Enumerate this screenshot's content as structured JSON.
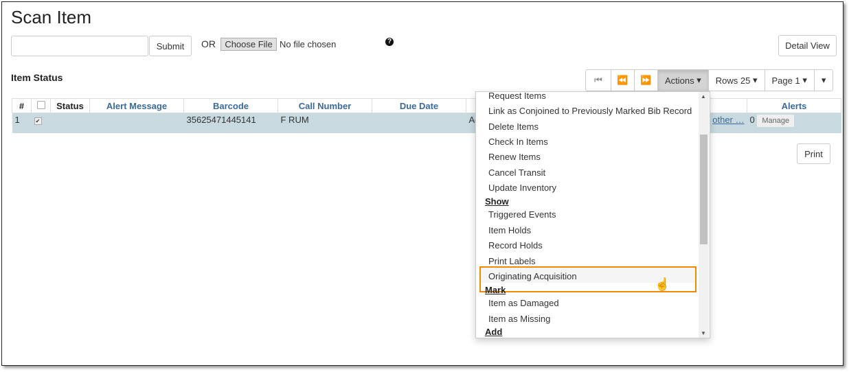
{
  "page": {
    "title": "Scan Item"
  },
  "scan": {
    "submit": "Submit",
    "or": "OR",
    "choose_file": "Choose File",
    "no_file": "No file chosen",
    "detail_view": "Detail View"
  },
  "section": {
    "title": "Item Status"
  },
  "toolbar": {
    "actions": "Actions",
    "rows": "Rows 25",
    "page": "Page 1"
  },
  "table": {
    "headers": [
      "#",
      "Status",
      "Alert Message",
      "Barcode",
      "Call Number",
      "Due Date",
      "Alerts"
    ],
    "row": {
      "num": "1",
      "barcode": "35625471445141",
      "call_number": "F RUM",
      "partial": "Ad",
      "link": "other …",
      "alerts": "0",
      "manage": "Manage"
    }
  },
  "print": "Print",
  "menu": {
    "items": [
      "Request Items",
      "Link as Conjoined to Previously Marked Bib Record",
      "Delete Items",
      "Check In Items",
      "Renew Items",
      "Cancel Transit",
      "Update Inventory"
    ],
    "show_header": "Show",
    "show_items": [
      "Triggered Events",
      "Item Holds",
      "Record Holds",
      "Print Labels",
      "Originating Acquisition"
    ],
    "mark_header": "Mark",
    "mark_items": [
      "Item as Damaged",
      "Item as Missing"
    ],
    "add_header": "Add"
  },
  "colors": {
    "highlight": "#f28a00",
    "row": "#c8dadf",
    "header_link": "#3a6a9b"
  }
}
